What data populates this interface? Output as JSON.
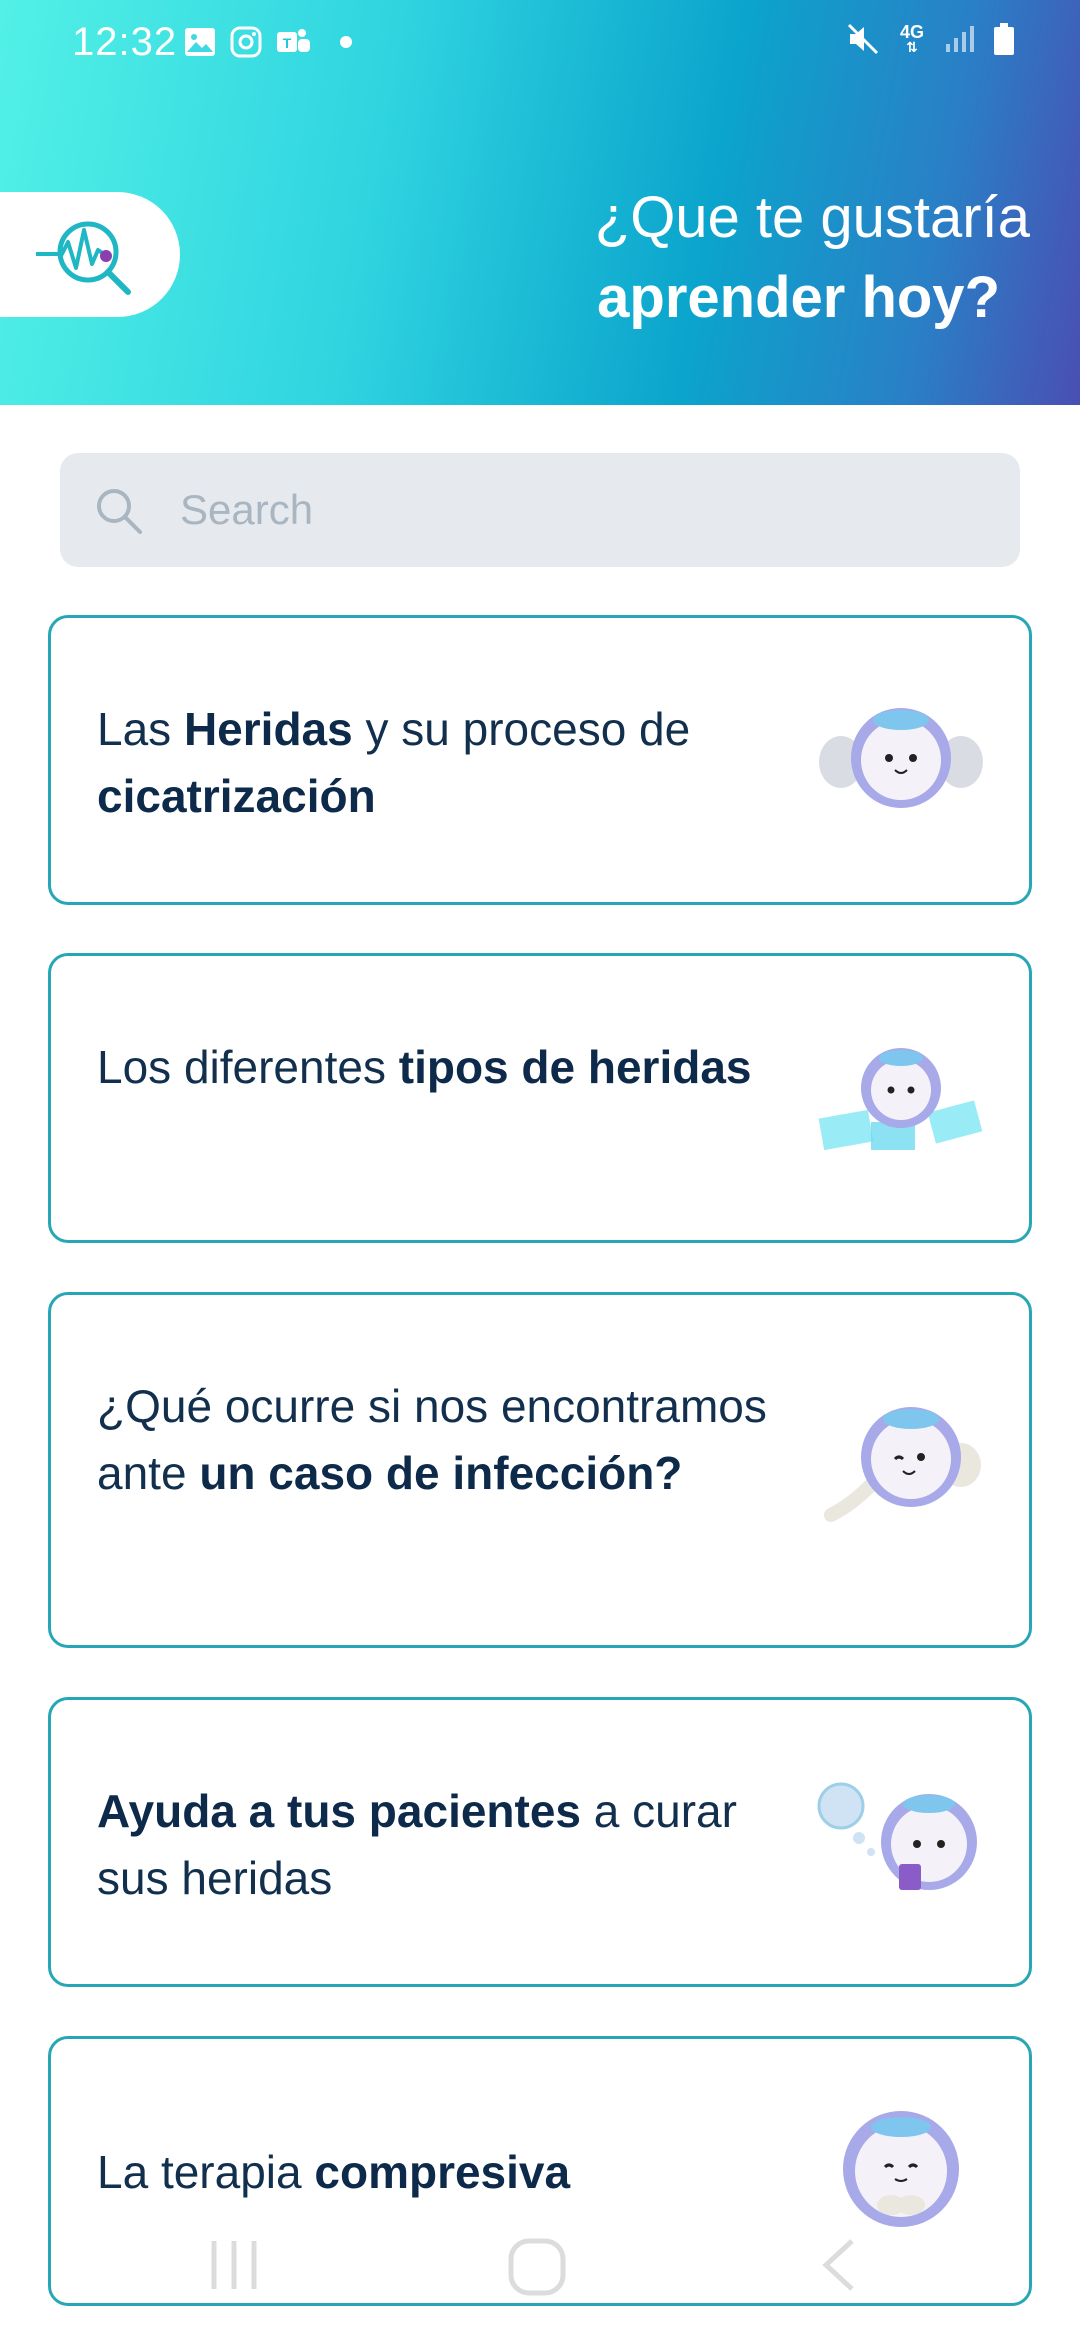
{
  "status_bar": {
    "time": "12:32",
    "network_type": "4G",
    "left_icons": [
      "gallery-icon",
      "instagram-icon",
      "teams-icon",
      "notification-dot"
    ],
    "right_icons": [
      "mute-icon",
      "network-4g-icon",
      "signal-icon",
      "battery-icon"
    ]
  },
  "header": {
    "title_line1": "¿Que te gustaría",
    "title_line2": "aprender hoy?",
    "logo_icon": "pulse-search-icon"
  },
  "search": {
    "placeholder": "Search",
    "value": ""
  },
  "topics": [
    {
      "parts": [
        {
          "t": "Las ",
          "b": false
        },
        {
          "t": "Heridas",
          "b": true
        },
        {
          "t": " y su proceso de ",
          "b": false
        },
        {
          "t": "cicatrización",
          "b": true
        }
      ],
      "mascot": "mascot-hands-icon"
    },
    {
      "parts": [
        {
          "t": "Los diferentes ",
          "b": false
        },
        {
          "t": "tipos de heridas",
          "b": true
        }
      ],
      "mascot": "mascot-screens-icon"
    },
    {
      "parts": [
        {
          "t": "¿Qué ocurre si nos encontramos ante ",
          "b": false
        },
        {
          "t": "un caso de infección?",
          "b": true
        }
      ],
      "mascot": "mascot-wave-icon"
    },
    {
      "parts": [
        {
          "t": "Ayuda a tus pacientes",
          "b": true
        },
        {
          "t": " a curar sus heridas",
          "b": false
        }
      ],
      "mascot": "mascot-thinking-icon"
    },
    {
      "parts": [
        {
          "t": "La terapia ",
          "b": false
        },
        {
          "t": "compresiva",
          "b": true
        }
      ],
      "mascot": "mascot-calm-icon"
    }
  ],
  "nav_bar": [
    "recents-icon",
    "home-icon",
    "back-icon"
  ],
  "colors": {
    "card_border": "#27a7b5",
    "text_dark": "#12304e",
    "header_start": "#52f0e6",
    "header_end": "#4a4fb3"
  }
}
